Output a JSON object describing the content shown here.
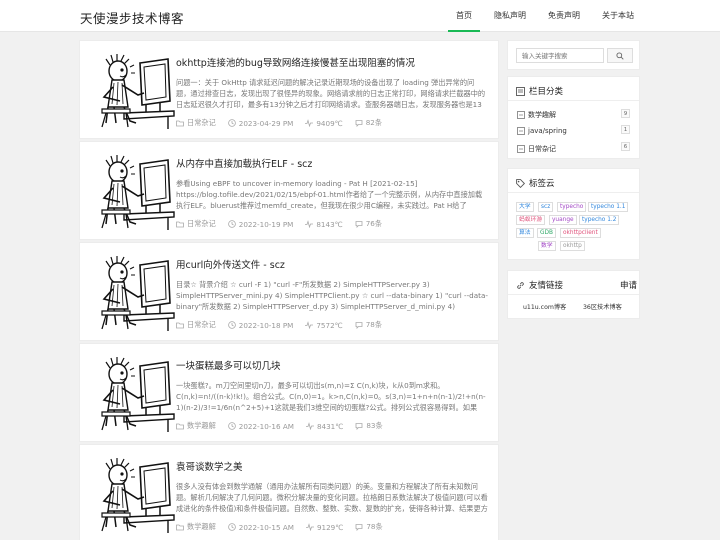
{
  "site": {
    "title": "天使漫步技术博客"
  },
  "nav": {
    "items": [
      {
        "label": "首页",
        "active": true
      },
      {
        "label": "隐私声明",
        "active": false
      },
      {
        "label": "免责声明",
        "active": false
      },
      {
        "label": "关于本站",
        "active": false
      }
    ]
  },
  "posts": [
    {
      "title": "okhttp连接池的bug导致网络连接慢甚至出现阻塞的情况",
      "excerpt": "问题一：关于 OkHttp 请求延迟问题的解决记录近期现场的设备出现了 loading 弹出异常的问题，通过排查日志，发现出现了很怪异的现象。网络请求前的日志正常打印，网络请求拦截器中的日志延迟很久才打印，最多有13分钟之后才打印网络请求。查服务器端日志，发现服务器也是13分钟之后…",
      "category": "日常杂记",
      "date": "2023-04-29 PM",
      "views": "9409℃",
      "comments": "82条"
    },
    {
      "title": "从内存中直接加载执行ELF - scz",
      "excerpt": "参看Using eBPF to uncover in-memory loading - Pat H [2021-02-15] https://blog.tofile.dev/2021/02/15/ebpf-01.html作者给了一个完整示例，从内存中直接加载执行ELF。bluerust推荐过memfd_create，但我现在很少用C编程，未实践过。Pat H给了Python版示例，演示…",
      "category": "日常杂记",
      "date": "2022-10-19 PM",
      "views": "8143℃",
      "comments": "76条"
    },
    {
      "title": "用curl向外传送文件 - scz",
      "excerpt": "目录☆ 背景介绍 ☆ curl -F 1) \"curl -F\"所发数据 2) SimpleHTTPServer.py 3) SimpleHTTPServer_mini.py 4) SimpleHTTPClient.py ☆ curl --data-binary 1) \"curl --data-binary\"所发数据 2) SimpleHTTPServer_d.py 3) SimpleHTTPServer_d_mini.py 4) SimpleHTTPClient_d.py ☆ …",
      "category": "日常杂记",
      "date": "2022-10-18 PM",
      "views": "7572℃",
      "comments": "78条"
    },
    {
      "title": "一块蛋糕最多可以切几块",
      "excerpt": "一块蛋糕?。m刀空间里切n刀，最多可以切出s(m,n)=Σ C(n,k)块，k从0到m求和。C(n,k)=n!/((n-k)!k!)。组合公式。C(n,0)=1。k>n,C(n,k)=0。s(3,n)=1+n+n(n-1)/2!+n(n-1)(n-2)/3!=1/6n(n^2+5)+1这就是我们3维空间的切蛋糕?公式。排列公式很容易得到。如果m>=n,s(m,n)=2^n。",
      "category": "数学趣解",
      "date": "2022-10-16 AM",
      "views": "8431℃",
      "comments": "83条"
    },
    {
      "title": "袁哥谈数学之美",
      "excerpt": "很多人没有体会到数学通解（通用办法解所有同类问题）的美。变量和方程解决了所有未知数问题。解析几何解决了几何问题。微积分解决量的变化问题。拉格朗日系数法解决了极值问题(可以看成进化的条件极值)和条件极值问题。自然数、整数、实数、复数的扩充，使得各种计算、结果更方便、完美…",
      "category": "数学趣解",
      "date": "2022-10-15 AM",
      "views": "9129℃",
      "comments": "78条"
    }
  ],
  "search": {
    "placeholder": "输入关键字搜索"
  },
  "categories": {
    "title": "栏目分类",
    "items": [
      {
        "label": "数学趣解",
        "count": "9"
      },
      {
        "label": "java/spring",
        "count": "1"
      },
      {
        "label": "日常杂记",
        "count": "6"
      }
    ]
  },
  "tags": {
    "title": "标签云",
    "items": [
      {
        "label": "大学",
        "color": "#3388dd"
      },
      {
        "label": "scz",
        "color": "#3388dd"
      },
      {
        "label": "typecho",
        "color": "#a349c6"
      },
      {
        "label": "typecho 1.1",
        "color": "#3388dd"
      },
      {
        "label": "蚂蚁环游",
        "color": "#e0527b"
      },
      {
        "label": "yuange",
        "color": "#a349c6"
      },
      {
        "label": "typecho 1.2",
        "color": "#3388dd"
      },
      {
        "label": "算法",
        "color": "#3388dd"
      },
      {
        "label": "GDB",
        "color": "#2ea866"
      },
      {
        "label": "okhttpclient",
        "color": "#e0527b"
      },
      {
        "label": "数学",
        "color": "#a349c6"
      },
      {
        "label": "okhttp",
        "color": "#999999"
      }
    ]
  },
  "links": {
    "title": "友情链接",
    "apply_label": "申请",
    "items": [
      {
        "label": "u11u.com博客"
      },
      {
        "label": "36区技术博客"
      }
    ]
  },
  "colors": {
    "accent": "#19b955",
    "active_nav_border": "#19b955"
  }
}
